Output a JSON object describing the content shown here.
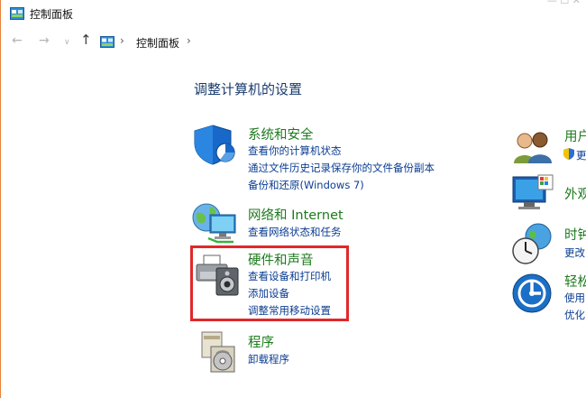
{
  "window": {
    "title": "控制面板",
    "controls_text": "— ☐ ✕"
  },
  "nav": {
    "back": "←",
    "forward": "→",
    "recent": "∨",
    "up": "↑",
    "sep": "›",
    "crumb": "控制面板",
    "sep2": "›"
  },
  "heading": "调整计算机的设置",
  "categories": [
    {
      "title": "系统和安全",
      "links": [
        "查看你的计算机状态",
        "通过文件历史记录保存你的文件备份副本",
        "备份和还原(Windows 7)"
      ]
    },
    {
      "title": "网络和 Internet",
      "links": [
        "查看网络状态和任务"
      ]
    },
    {
      "title": "硬件和声音",
      "links": [
        "查看设备和打印机",
        "添加设备",
        "调整常用移动设置"
      ]
    },
    {
      "title": "程序",
      "links": [
        "卸载程序"
      ]
    }
  ],
  "right_categories": [
    {
      "title": "用户",
      "links": [
        "更"
      ]
    },
    {
      "title": "外观"
    },
    {
      "title": "时钟",
      "links": [
        "更改"
      ]
    },
    {
      "title": "轻松",
      "links": [
        "使用",
        "优化"
      ]
    }
  ],
  "colors": {
    "title_green": "#1e7a1e",
    "link_blue": "#0b3d91",
    "highlight": "#e0282a",
    "heading": "#1a3c6e"
  }
}
